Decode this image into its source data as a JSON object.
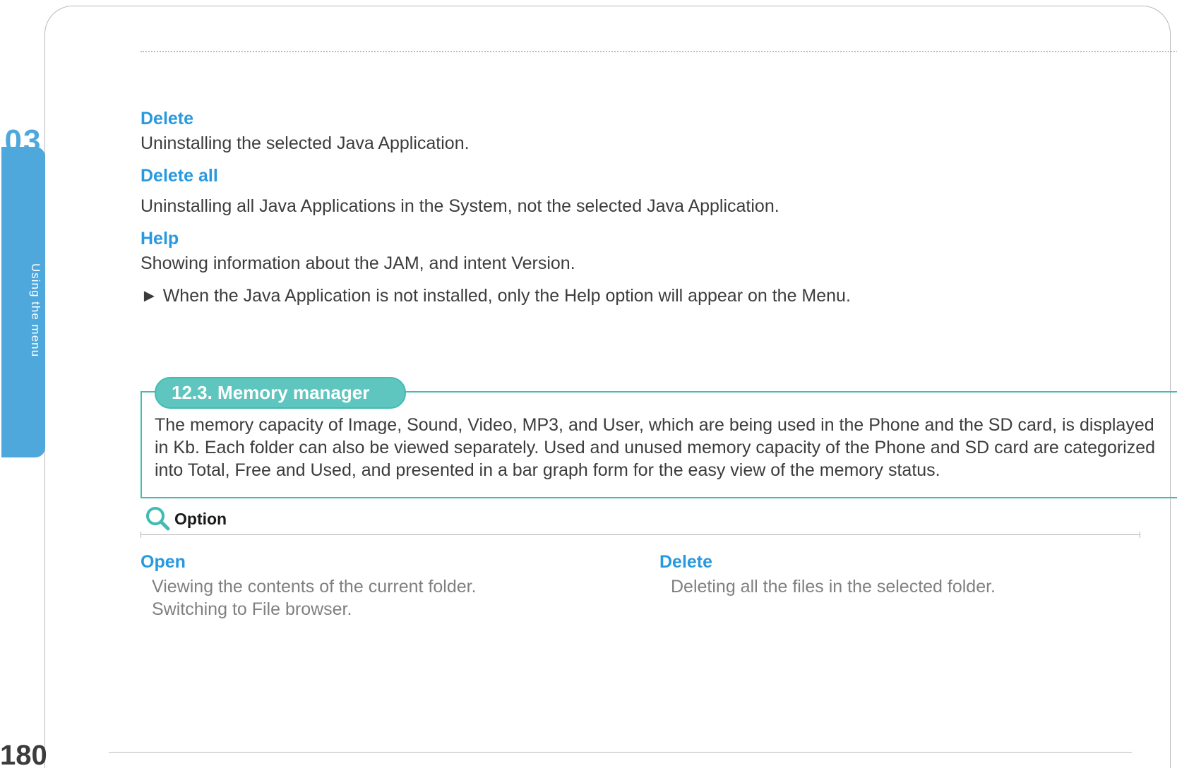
{
  "sidebar": {
    "chapter_number": "03",
    "tab_label": "Using the menu"
  },
  "sections": {
    "delete": {
      "title": "Delete",
      "body": "Uninstalling the selected Java Application."
    },
    "delete_all": {
      "title": "Delete all",
      "body": "Uninstalling all Java Applications in the System, not the selected Java Application."
    },
    "help": {
      "title": "Help",
      "body": "Showing information about the JAM, and intent Version."
    },
    "note": "► When the Java Application is not installed, only the Help option will appear on the Menu."
  },
  "memory_manager": {
    "heading": "12.3. Memory manager",
    "body": "The memory capacity of Image, Sound, Video, MP3, and User, which are being used in the Phone and the SD card, is displayed in Kb. Each folder can also be viewed separately. Used and unused memory capacity of the Phone and SD card are categorized into Total, Free and Used, and presented in a bar graph form for the easy view of the memory status."
  },
  "option": {
    "label": "Option",
    "open": {
      "title": "Open",
      "line1": "Viewing the contents of the current folder.",
      "line2": "Switching to File browser."
    },
    "delete": {
      "title": "Delete",
      "line1": "Deleting all the files in the selected folder."
    }
  },
  "page_number": "180"
}
